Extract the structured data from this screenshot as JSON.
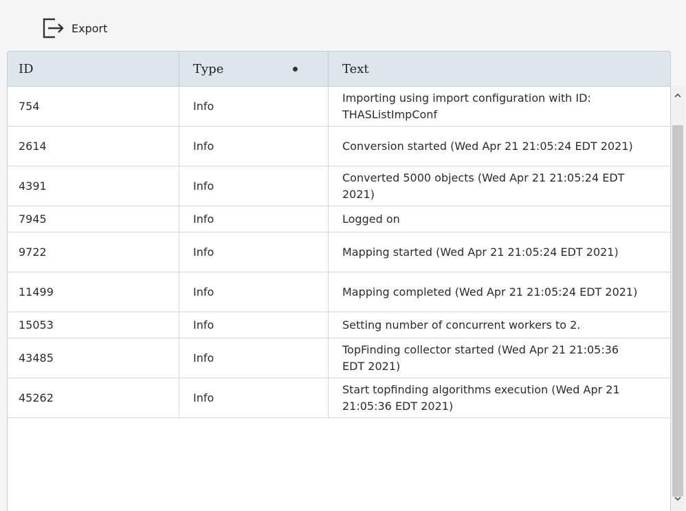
{
  "toolbar": {
    "export_label": "Export",
    "export_icon": "export-icon"
  },
  "table": {
    "columns": [
      {
        "label": "ID"
      },
      {
        "label": "Type"
      },
      {
        "label": "Text"
      }
    ],
    "sorted_column": "Type",
    "rows": [
      {
        "id": "754",
        "type": "Info",
        "text": "Importing using import configuration with ID: THASListImpConf"
      },
      {
        "id": "2614",
        "type": "Info",
        "text": "Conversion started (Wed Apr 21 21:05:24 EDT 2021)"
      },
      {
        "id": "4391",
        "type": "Info",
        "text": "Converted 5000 objects (Wed Apr 21 21:05:24 EDT 2021)"
      },
      {
        "id": "7945",
        "type": "Info",
        "text": "Logged on"
      },
      {
        "id": "9722",
        "type": "Info",
        "text": "Mapping started (Wed Apr 21 21:05:24 EDT 2021)"
      },
      {
        "id": "11499",
        "type": "Info",
        "text": "Mapping completed (Wed Apr 21 21:05:24 EDT 2021)"
      },
      {
        "id": "15053",
        "type": "Info",
        "text": "Setting number of concurrent workers to 2."
      },
      {
        "id": "43485",
        "type": "Info",
        "text": "TopFinding collector started (Wed Apr 21 21:05:36 EDT 2021)"
      },
      {
        "id": "45262",
        "type": "Info",
        "text": "Start topfinding algorithms execution (Wed Apr 21 21:05:36 EDT 2021)"
      }
    ]
  },
  "scrollbar": {
    "up_glyph": "^",
    "down_glyph": "v"
  }
}
